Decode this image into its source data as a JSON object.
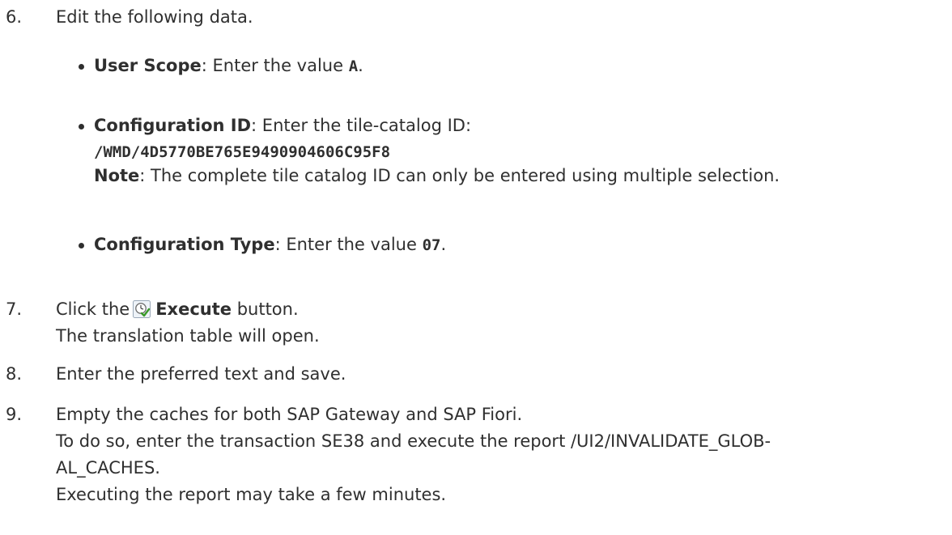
{
  "steps": [
    {
      "num": "6.",
      "text": "Edit the following data."
    },
    {
      "num": "7.",
      "pre": "Click the",
      "bold": "Execute",
      "post": " button.",
      "line2": "The translation table will open."
    },
    {
      "num": "8.",
      "text": "Enter the preferred text and save."
    },
    {
      "num": "9.",
      "line1": "Empty the caches for both SAP Gateway and SAP Fiori.",
      "line2": "To do so, enter the transaction SE38 and execute the report /UI2/INVALIDATE_GLOB-",
      "line3": "AL_CACHES.",
      "line4": "Executing the report may take a few minutes."
    }
  ],
  "bullets": [
    {
      "label": "User Scope",
      "sep": ": Enter the value ",
      "value": "A",
      "end": "."
    },
    {
      "label": "Configuration ID",
      "sep": ": Enter the tile-catalog ID:",
      "value": "/WMD/4D5770BE765E9490904606C95F8",
      "note_label": "Note",
      "note_text": ": The complete tile catalog ID can only be entered using multiple selection."
    },
    {
      "label": "Configuration Type",
      "sep": ": Enter the value ",
      "value": "07",
      "end": "."
    }
  ],
  "icons": {
    "execute": "execute-clock-check-icon"
  }
}
